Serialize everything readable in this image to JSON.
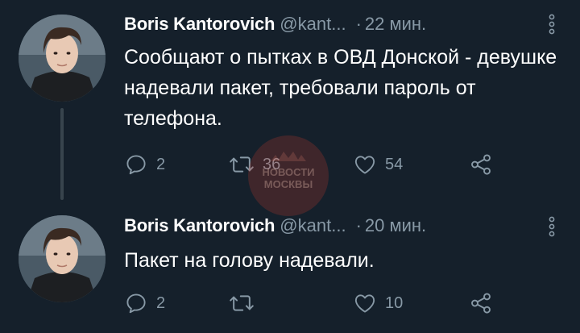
{
  "tweets": [
    {
      "author": {
        "display_name": "Boris Kantorovich",
        "handle": "@kant...",
        "avatar_icon": "user-avatar"
      },
      "separator": "·",
      "time": "22 мин.",
      "text": "Сообщают о пытках в ОВД Донской - девушке надевали пакет, требовали пароль от телефона.",
      "actions": {
        "reply": {
          "icon": "reply-icon",
          "count": "2"
        },
        "retweet": {
          "icon": "retweet-icon",
          "count": "36"
        },
        "like": {
          "icon": "heart-icon",
          "count": "54"
        },
        "share": {
          "icon": "share-icon"
        }
      }
    },
    {
      "author": {
        "display_name": "Boris Kantorovich",
        "handle": "@kant...",
        "avatar_icon": "user-avatar"
      },
      "separator": "·",
      "time": "20 мин.",
      "text": "Пакет на голову надевали.",
      "actions": {
        "reply": {
          "icon": "reply-icon",
          "count": "2"
        },
        "retweet": {
          "icon": "retweet-icon",
          "count": ""
        },
        "like": {
          "icon": "heart-icon",
          "count": "10"
        },
        "share": {
          "icon": "share-icon"
        }
      }
    }
  ],
  "watermark": {
    "line1": "НОВОСТИ",
    "line2": "МОСКВЫ"
  },
  "colors": {
    "background": "#15202b",
    "text_primary": "#ffffff",
    "text_secondary": "#8899a6",
    "thread_line": "#38444d",
    "watermark": "#c0392b"
  }
}
